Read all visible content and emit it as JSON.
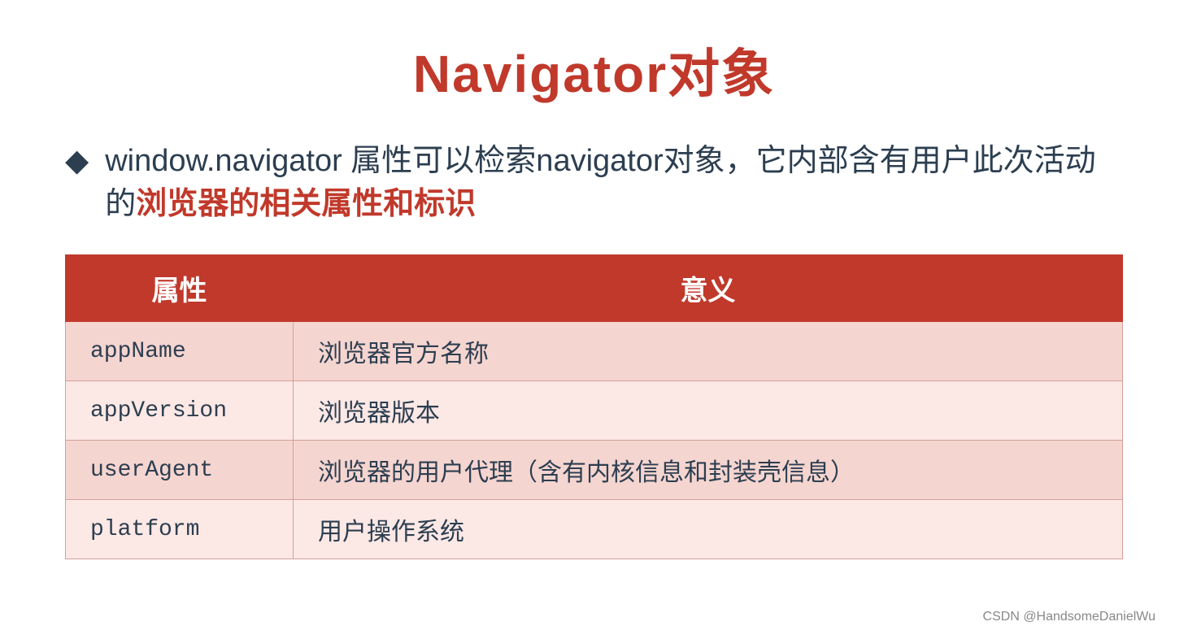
{
  "title": "Navigator对象",
  "bullet": {
    "diamond": "◆",
    "text_part1": " window.navigator 属性可以检索navigator对象，它内部含有用户此次活动的",
    "text_highlight": "浏览器的相关属性和标识",
    "text_part2": ""
  },
  "table": {
    "headers": [
      "属性",
      "意义"
    ],
    "rows": [
      {
        "property": "appName",
        "meaning": "浏览器官方名称"
      },
      {
        "property": "appVersion",
        "meaning": "浏览器版本"
      },
      {
        "property": "userAgent",
        "meaning": "浏览器的用户代理（含有内核信息和封装壳信息）"
      },
      {
        "property": "platform",
        "meaning": "用户操作系统"
      }
    ]
  },
  "watermark": "CSDN @HandsomeDanielWu"
}
